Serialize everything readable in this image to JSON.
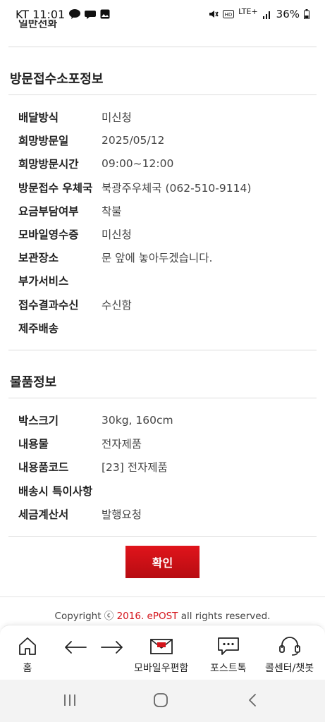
{
  "status_bar": {
    "carrier_time": "KT 11:01",
    "network": "LTE+",
    "battery": "36%",
    "icons_left": [
      "talk-icon",
      "chat-bubble-icon",
      "gallery-icon"
    ],
    "icons_right": [
      "mute-icon",
      "hd-icon",
      "signal-icon",
      "battery-icon"
    ]
  },
  "cut_title": "일반전화",
  "visit_section": {
    "title": "방문접수소포정보",
    "rows": [
      {
        "label": "배달방식",
        "value": "미신청"
      },
      {
        "label": "희망방문일",
        "value": "2025/05/12"
      },
      {
        "label": "희망방문시간",
        "value": "09:00~12:00"
      },
      {
        "label": "방문접수 우체국",
        "value": "북광주우체국 (062-510-9114)"
      },
      {
        "label": "요금부담여부",
        "value": "착불"
      },
      {
        "label": "모바일영수증",
        "value": "미신청"
      },
      {
        "label": "보관장소",
        "value": "문 앞에 놓아두겠습니다."
      },
      {
        "label": "부가서비스",
        "value": ""
      },
      {
        "label": "접수결과수신",
        "value": "수신함"
      },
      {
        "label": "제주배송",
        "value": ""
      }
    ]
  },
  "goods_section": {
    "title": "물품정보",
    "rows": [
      {
        "label": "박스크기",
        "value": "30kg, 160cm"
      },
      {
        "label": "내용물",
        "value": "전자제품"
      },
      {
        "label": "내용품코드",
        "value": "[23] 전자제품"
      },
      {
        "label": "배송시 특이사항",
        "value": ""
      },
      {
        "label": "세금계산서",
        "value": "발행요청"
      }
    ]
  },
  "confirm_label": "확인",
  "copyright": {
    "prefix": "Copyright ⓒ ",
    "highlight": "2016. ePOST",
    "suffix": " all rights reserved."
  },
  "bottom_nav": {
    "home": "홈",
    "mailbox": "모바일우편함",
    "posttalk": "포스트톡",
    "callcenter": "콜센터/챗봇"
  },
  "colors": {
    "accent": "#d4141b",
    "divider": "#dcdcdc"
  }
}
